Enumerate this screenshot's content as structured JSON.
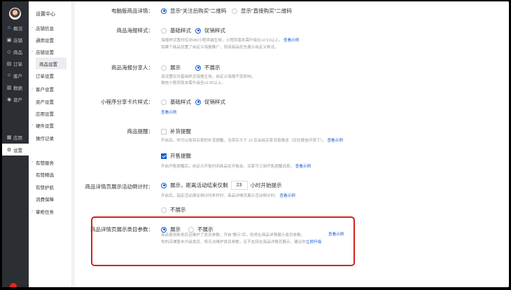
{
  "nav1": {
    "items": [
      {
        "icon": "home-icon",
        "glyph": "⌂",
        "label": "概况"
      },
      {
        "icon": "store-icon",
        "glyph": "▣",
        "label": "店铺"
      },
      {
        "icon": "tag-icon",
        "glyph": "◇",
        "label": "商品"
      },
      {
        "icon": "order-icon",
        "glyph": "▤",
        "label": "订单"
      },
      {
        "icon": "customer-icon",
        "glyph": "☺",
        "label": "客户"
      },
      {
        "icon": "data-icon",
        "glyph": "▥",
        "label": "数据"
      },
      {
        "icon": "asset-icon",
        "glyph": "◉",
        "label": "资产"
      },
      {
        "icon": "apps-icon",
        "glyph": "▦",
        "label": "应用"
      },
      {
        "icon": "gear-icon",
        "glyph": "⚙",
        "label": "设置"
      }
    ]
  },
  "nav2": {
    "title": "设置中心",
    "items": [
      {
        "label": "店铺信息",
        "type": "group"
      },
      {
        "label": "通用设置",
        "type": "sub"
      },
      {
        "label": "店铺设置",
        "type": "group"
      },
      {
        "label": "商品设置",
        "type": "selected"
      },
      {
        "label": "订单设置",
        "type": "sub"
      },
      {
        "label": "客户设置",
        "type": "group"
      },
      {
        "label": "资产设置",
        "type": "sub"
      },
      {
        "label": "应用设置",
        "type": "sub"
      },
      {
        "label": "硬件设置",
        "type": "group"
      },
      {
        "label": "操作记录",
        "type": "sub"
      },
      {
        "label": "有赞服务",
        "type": "group"
      },
      {
        "label": "有赞精选",
        "type": "sub"
      },
      {
        "label": "有赞护航",
        "type": "sub"
      },
      {
        "label": "消费保障",
        "type": "sub"
      },
      {
        "label": "掌柜任务",
        "type": "group"
      }
    ]
  },
  "settings": {
    "pc_detail": {
      "label": "电脑版商品详情：",
      "opt1": "显示\"关注后购买\"二维码",
      "opt2": "显示\"直接购买\"二维码"
    },
    "poster_style": {
      "label": "商品海报样式：",
      "opt1": "基础样式",
      "opt2": "促销样式",
      "help1": "海报样式暂时仅对H5/小程序端生效，小程序版本需升级在v2.51以上。",
      "help1_link": "查看示例",
      "help2": "如果个商品设置了自定义海报推广，则该商品优先展示自定义样式。"
    },
    "poster_sharer": {
      "label": "商品海报分享人：",
      "opt1": "展示",
      "opt2": "不展示",
      "help1": "该设置仅对基础样式海报生效，自定义海报不受影响。",
      "help2": "微信小程序版本需升级至v2.55以上。"
    },
    "mini_card": {
      "label": "小程序分享卡片样式：",
      "opt1": "基础样式",
      "opt2": "促销样式",
      "link": "查看示例"
    },
    "reminder": {
      "label": "商品提醒：",
      "opt1": "补货提醒",
      "help1": "开启后，你可以收到买家的补货提醒，当库存大于 10 后会给买家消息推送（仅在微信环境下）。",
      "help1_link": "查看示例",
      "opt2": "开售提醒",
      "help2": "开启开售提醒后，自定义开售时间商品在开售前，买家可订阅开售提醒消息。",
      "help2_link": "查看示例"
    },
    "countdown": {
      "label": "商品详情页展示活动倒计时：",
      "opt1_pre": "展示，距离活动结束仅剩",
      "hours": "23",
      "opt1_post": "小时开始提示",
      "help": "开启后，指定活动满足倒计时条件时，商品详情页展示活动倒计时。",
      "help_link": "查看示例",
      "opt2": "不展示"
    },
    "category_param": {
      "label": "商品详情页展示类目参数：",
      "opt1": "展示",
      "opt2": "不展示",
      "link": "查看示例",
      "help1": "商品使用新类目且维护了类目参数，开启\"展示\"后，则将在商品详情展示类目参数。",
      "help2": "你的店铺暂未升级类目，将无法维护类目参数，且不支持在商品详情页展示，建议你",
      "help2_link": "立即升级"
    }
  }
}
